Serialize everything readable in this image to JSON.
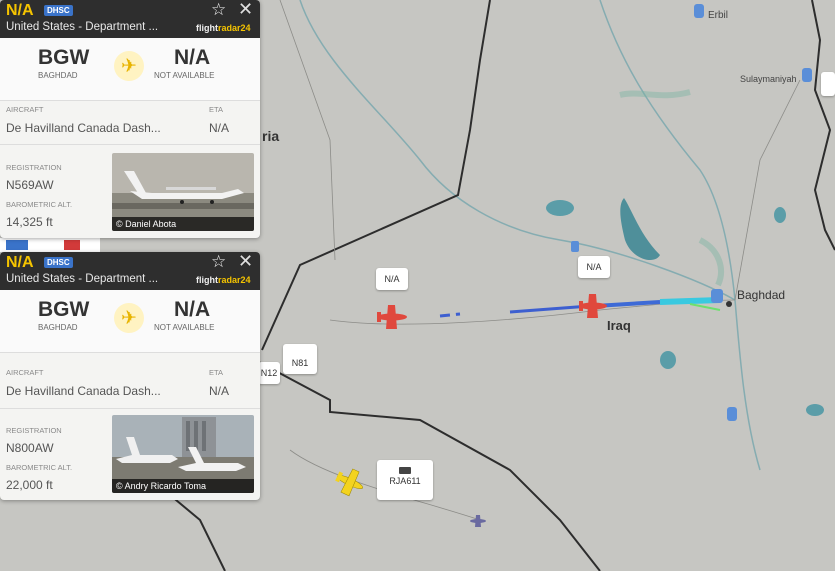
{
  "map": {
    "labels": {
      "city_baghdad": "Baghdad",
      "country_iraq": "Iraq",
      "fragment_ria": "ria",
      "city_erbil": "Erbil",
      "city_sulaymaniyah": "Sulaymaniyah"
    },
    "tags": {
      "na_1": "N/A",
      "na_2": "N/A",
      "n81": "N81",
      "n12": "N12",
      "rja_callsign": "RJA611"
    },
    "colors": {
      "background": "#c6c6c2",
      "water": "#4f8f9a",
      "track_blue": "#3d5fd0",
      "track_cyan": "#39c9e0",
      "aircraft_red": "#e0483d",
      "aircraft_yellow": "#f3d31f"
    }
  },
  "panels": [
    {
      "callsign": "N/A",
      "badge": "DHSC",
      "operator": "United States - Department ...",
      "fr24_prefix": "flight",
      "fr24_suffix": "radar24",
      "origin_code": "BGW",
      "origin_city": "BAGHDAD",
      "dest_code": "N/A",
      "dest_city": "NOT AVAILABLE",
      "aircraft_label": "AIRCRAFT",
      "aircraft_value": "De Havilland Canada Dash...",
      "eta_label": "ETA",
      "eta_value": "N/A",
      "registration_label": "REGISTRATION",
      "registration_value": "N569AW",
      "alt_label": "BAROMETRIC ALT.",
      "alt_value": "14,325 ft",
      "photo_credit": "© Daniel Abota"
    },
    {
      "callsign": "N/A",
      "badge": "DHSC",
      "operator": "United States - Department ...",
      "fr24_prefix": "flight",
      "fr24_suffix": "radar24",
      "origin_code": "BGW",
      "origin_city": "BAGHDAD",
      "dest_code": "N/A",
      "dest_city": "NOT AVAILABLE",
      "aircraft_label": "AIRCRAFT",
      "aircraft_value": "De Havilland Canada Dash...",
      "eta_label": "ETA",
      "eta_value": "N/A",
      "registration_label": "REGISTRATION",
      "registration_value": "N800AW",
      "alt_label": "BAROMETRIC ALT.",
      "alt_value": "22,000 ft",
      "photo_credit": "© Andry Ricardo Toma"
    }
  ],
  "icons": {
    "star": "star-icon",
    "close": "close-icon",
    "plane": "airplane-icon"
  }
}
